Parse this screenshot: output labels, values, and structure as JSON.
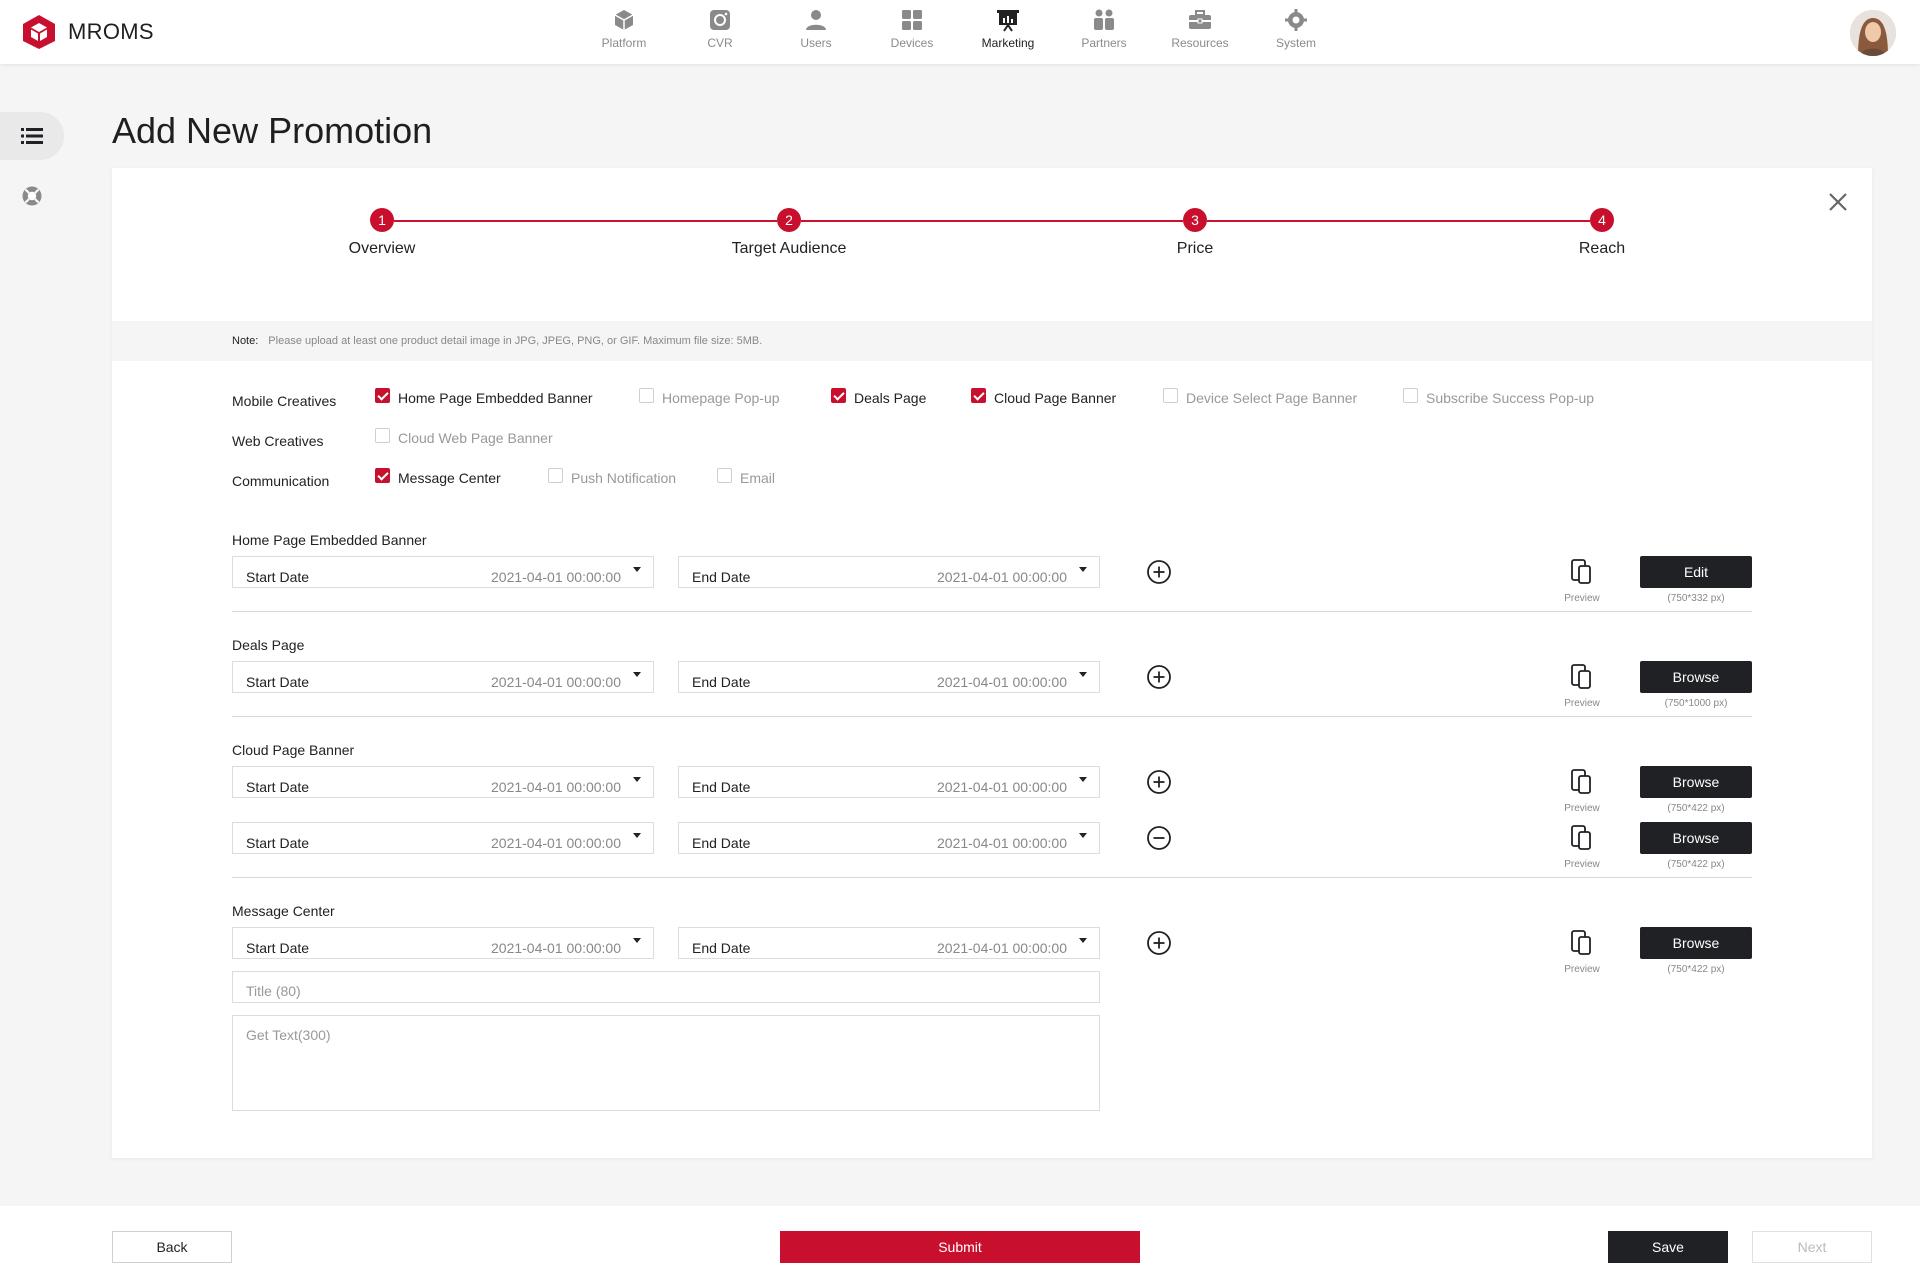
{
  "app": {
    "name": "MROMS"
  },
  "nav": [
    {
      "label": "Platform",
      "icon": "cube-icon",
      "active": false
    },
    {
      "label": "CVR",
      "icon": "camera-icon",
      "active": false
    },
    {
      "label": "Users",
      "icon": "user-icon",
      "active": false
    },
    {
      "label": "Devices",
      "icon": "devices-grid-icon",
      "active": false
    },
    {
      "label": "Marketing",
      "icon": "presentation-icon",
      "active": true
    },
    {
      "label": "Partners",
      "icon": "partners-icon",
      "active": false
    },
    {
      "label": "Resources",
      "icon": "toolbox-icon",
      "active": false
    },
    {
      "label": "System",
      "icon": "gear-icon",
      "active": false
    }
  ],
  "sidebar": {
    "items": [
      {
        "icon": "list-icon",
        "active": true
      },
      {
        "icon": "support-icon",
        "active": false
      }
    ]
  },
  "page": {
    "title": "Add New Promotion"
  },
  "steps": [
    {
      "number": "1",
      "label": "Overview"
    },
    {
      "number": "2",
      "label": "Target Audience"
    },
    {
      "number": "3",
      "label": "Price"
    },
    {
      "number": "4",
      "label": "Reach"
    }
  ],
  "note": {
    "label": "Note:",
    "text": "Please upload at least one product detail image in JPG, JPEG, PNG, or GIF.   Maximum file size: 5MB."
  },
  "creative_options": {
    "mobile": {
      "label": "Mobile Creatives",
      "items": [
        {
          "label": "Home Page Embedded Banner",
          "checked": true
        },
        {
          "label": "Homepage Pop-up",
          "checked": false
        },
        {
          "label": "Deals Page",
          "checked": true
        },
        {
          "label": "Cloud Page Banner",
          "checked": true
        },
        {
          "label": "Device Select Page Banner",
          "checked": false
        },
        {
          "label": "Subscribe Success Pop-up",
          "checked": false
        }
      ]
    },
    "web": {
      "label": "Web Creatives",
      "items": [
        {
          "label": "Cloud Web Page Banner",
          "checked": false
        }
      ]
    },
    "communication": {
      "label": "Communication",
      "items": [
        {
          "label": "Message Center",
          "checked": true
        },
        {
          "label": "Push Notification",
          "checked": false
        },
        {
          "label": "Email",
          "checked": false
        }
      ]
    }
  },
  "sections": {
    "home_banner": {
      "title": "Home Page Embedded Banner",
      "rows": [
        {
          "start_label": "Start Date",
          "start_value": "2021-04-01 00:00:00",
          "end_label": "End Date",
          "end_value": "2021-04-01 00:00:00",
          "action_icon": "plus-circle-icon",
          "preview_label": "Preview",
          "button": "Edit",
          "size_note": "(750*332 px)"
        }
      ]
    },
    "deals": {
      "title": "Deals Page",
      "rows": [
        {
          "start_label": "Start Date",
          "start_value": "2021-04-01 00:00:00",
          "end_label": "End Date",
          "end_value": "2021-04-01 00:00:00",
          "action_icon": "plus-circle-icon",
          "preview_label": "Preview",
          "button": "Browse",
          "size_note": "(750*1000 px)"
        }
      ]
    },
    "cloud": {
      "title": "Cloud Page Banner",
      "rows": [
        {
          "start_label": "Start Date",
          "start_value": "2021-04-01 00:00:00",
          "end_label": "End Date",
          "end_value": "2021-04-01 00:00:00",
          "action_icon": "plus-circle-icon",
          "preview_label": "Preview",
          "button": "Browse",
          "size_note": "(750*422 px)"
        },
        {
          "start_label": "Start Date",
          "start_value": "2021-04-01 00:00:00",
          "end_label": "End Date",
          "end_value": "2021-04-01 00:00:00",
          "action_icon": "minus-circle-icon",
          "preview_label": "Preview",
          "button": "Browse",
          "size_note": "(750*422 px)"
        }
      ]
    },
    "message": {
      "title": "Message Center",
      "rows": [
        {
          "start_label": "Start Date",
          "start_value": "2021-04-01 00:00:00",
          "end_label": "End Date",
          "end_value": "2021-04-01 00:00:00",
          "action_icon": "plus-circle-icon",
          "preview_label": "Preview",
          "button": "Browse",
          "size_note": "(750*422 px)"
        }
      ],
      "title_placeholder": "Title (80)",
      "text_placeholder": "Get Text(300)"
    }
  },
  "footer": {
    "back": "Back",
    "submit": "Submit",
    "save": "Save",
    "next": "Next"
  },
  "colors": {
    "accent": "#c8102e",
    "dark_button": "#1f2125"
  }
}
